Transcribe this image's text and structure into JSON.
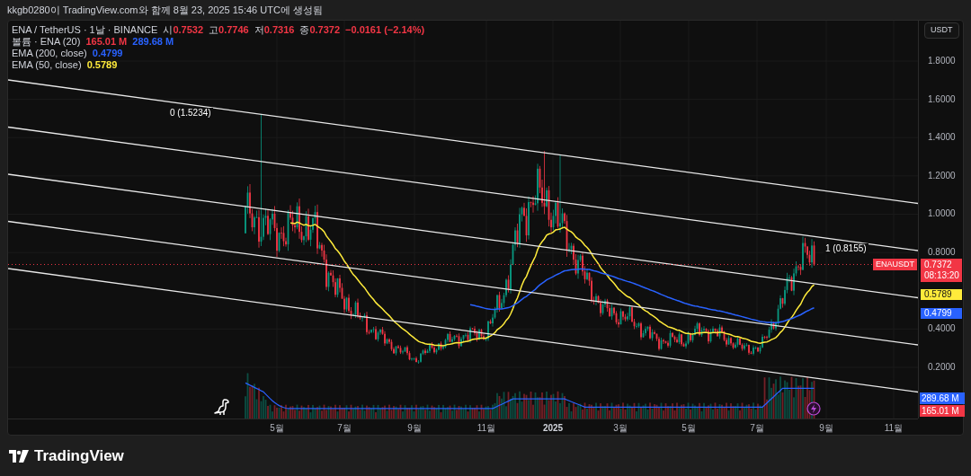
{
  "header": {
    "caption": "kkgb0280이 TradingView.com와 함께 8월 23, 2025 15:46 UTC에 생성됨"
  },
  "legend": [
    {
      "label": "ENA / TetherUS · 1날 · BINANCE",
      "values": [
        {
          "prefix": "시",
          "text": "0.7532",
          "color": "#f23645"
        },
        {
          "prefix": "고",
          "text": "0.7746",
          "color": "#f23645"
        },
        {
          "prefix": "저",
          "text": "0.7316",
          "color": "#f23645"
        },
        {
          "prefix": "종",
          "text": "0.7372",
          "color": "#f23645"
        },
        {
          "text": "−0.0161 (−2.14%)",
          "color": "#f23645"
        }
      ]
    },
    {
      "label": "볼륨 · ENA (20)",
      "values": [
        {
          "text": "165.01 M",
          "color": "#f23645"
        },
        {
          "text": "289.68 M",
          "color": "#2962ff"
        }
      ]
    },
    {
      "label": "EMA (200, close)",
      "values": [
        {
          "text": "0.4799",
          "color": "#2962ff"
        }
      ]
    },
    {
      "label": "EMA (50, close)",
      "values": [
        {
          "text": "0.5789",
          "color": "#ffeb3b"
        }
      ]
    }
  ],
  "channel_labels": [
    "0 (1.5234)",
    "1 (0.8155)"
  ],
  "price_axis": {
    "currency_button": "USDT",
    "y_ticks": [
      "1.8000",
      "1.6000",
      "1.4000",
      "1.2000",
      "1.0000",
      "0.8000",
      "0.4000",
      "0.2000"
    ],
    "tags": [
      {
        "kind": "symbol",
        "text": "ENAUSDT",
        "color": "#f23645"
      },
      {
        "kind": "price",
        "text": "0.7372",
        "countdown": "08:13:20",
        "color": "#f23645"
      },
      {
        "kind": "price",
        "text": "0.5789",
        "color": "#ffeb3b"
      },
      {
        "kind": "price",
        "text": "0.4799",
        "color": "#2962ff"
      },
      {
        "kind": "volume",
        "text": "289.68 M",
        "color": "#2962ff"
      },
      {
        "kind": "volume",
        "text": "165.01 M",
        "color": "#f23645"
      }
    ]
  },
  "time_axis": {
    "x_ticks": [
      {
        "text": "5월",
        "kind": "month"
      },
      {
        "text": "7월",
        "kind": "month"
      },
      {
        "text": "9월",
        "kind": "month"
      },
      {
        "text": "11월",
        "kind": "month"
      },
      {
        "text": "2025",
        "kind": "year"
      },
      {
        "text": "3월",
        "kind": "month"
      },
      {
        "text": "5월",
        "kind": "month"
      },
      {
        "text": "7월",
        "kind": "month"
      },
      {
        "text": "9월",
        "kind": "month"
      },
      {
        "text": "11월",
        "kind": "month"
      }
    ]
  },
  "footer": {
    "brand": "TradingView"
  }
}
